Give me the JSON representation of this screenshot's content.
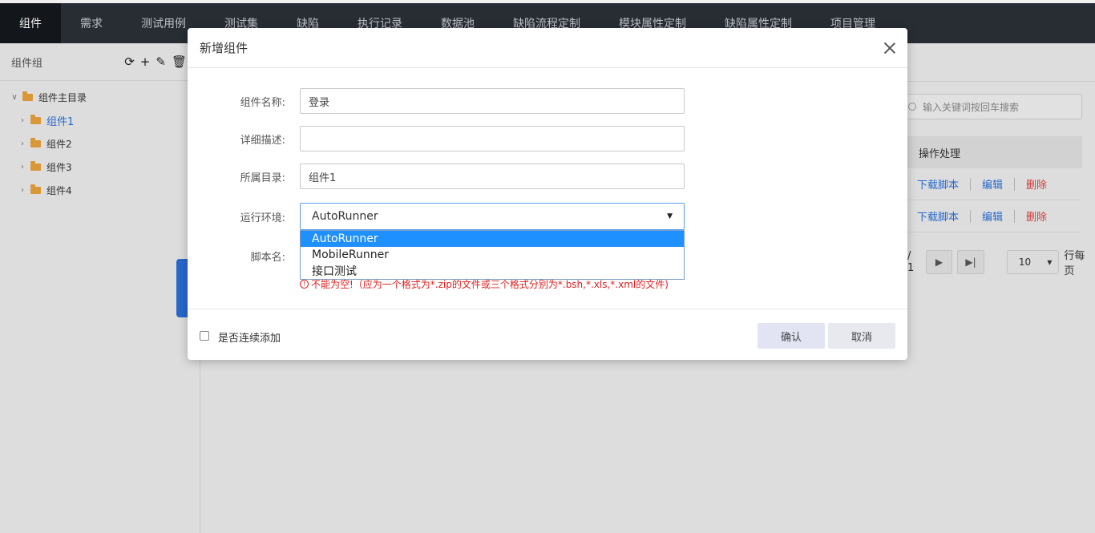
{
  "nav": {
    "tabs": [
      "组件",
      "需求",
      "测试用例",
      "测试集",
      "缺陷",
      "执行记录",
      "数据池",
      "缺陷流程定制",
      "模块属性定制",
      "缺陷属性定制",
      "项目管理"
    ],
    "active_index": 0
  },
  "sidebar": {
    "title": "组件组",
    "tree": {
      "root": "组件主目录",
      "children": [
        "组件1",
        "组件2",
        "组件3",
        "组件4"
      ],
      "selected_index": 0
    }
  },
  "background": {
    "search_placeholder": "输入关键词按回车搜索",
    "table_header": "操作处理",
    "row_actions": {
      "download": "下载脚本",
      "edit": "编辑",
      "delete": "删除"
    },
    "pager": {
      "page_text": "/ 1",
      "page_size": "10",
      "per_page_label": "行每页"
    }
  },
  "dialog": {
    "title": "新增组件",
    "fields": {
      "name": {
        "label": "组件名称:",
        "value": "登录"
      },
      "description": {
        "label": "详细描述:",
        "value": ""
      },
      "directory": {
        "label": "所属目录:",
        "value": "组件1"
      },
      "environment": {
        "label": "运行环境:",
        "value": "AutoRunner"
      },
      "script": {
        "label": "脚本名:"
      }
    },
    "environment_options": [
      "AutoRunner",
      "MobileRunner",
      "接口测试"
    ],
    "environment_selected_index": 0,
    "error_text": "不能为空!（应为一个格式为*.zip的文件或三个格式分别为*.bsh,*.xls,*.xml的文件)",
    "continue_label": "是否连续添加",
    "ok_label": "确认",
    "cancel_label": "取消"
  }
}
